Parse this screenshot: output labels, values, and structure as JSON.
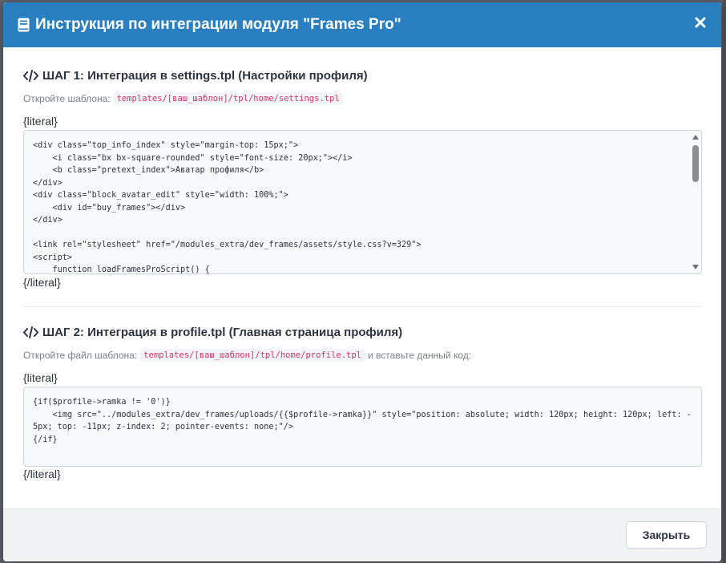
{
  "modal": {
    "title": "Инструкция по интеграции модуля \"Frames Pro\"",
    "close_label": "×",
    "footer_button_label": "Закрыть"
  },
  "step1": {
    "title": "ШАГ 1: Интеграция в settings.tpl (Настройки профиля)",
    "hint_prefix": "Откройте шаблона:",
    "path": "templates/[ваш_шаблон]/tpl/home/settings.tpl",
    "literal_open": "{literal}",
    "literal_close": "{/literal}",
    "code": "<div class=\"top_info_index\" style=\"margin-top: 15px;\">\n    <i class=\"bx bx-square-rounded\" style=\"font-size: 20px;\"></i>\n    <b class=\"pretext_index\">Аватар профиля</b>\n</div>\n<div class=\"block_avatar_edit\" style=\"width: 100%;\">\n    <div id=\"buy_frames\"></div>\n</div>\n\n<link rel=\"stylesheet\" href=\"/modules_extra/dev_frames/assets/style.css?v=329\">\n<script>\n    function loadFramesProScript() {"
  },
  "step2": {
    "title": "ШАГ 2: Интеграция в profile.tpl (Главная страница профиля)",
    "hint_prefix": "Откройте файл шаблона:",
    "path": "templates/[ваш_шаблон]/tpl/home/profile.tpl",
    "hint_suffix": "и вставьте данный код:",
    "literal_open": "{literal}",
    "literal_close": "{/literal}",
    "code": "{if($profile->ramka != '0')}\n    <img src=\"../modules_extra/dev_frames/uploads/{{$profile->ramka}}\" style=\"position: absolute; width: 120px; height: 120px; left: -5px; top: -11px; z-index: 2; pointer-events: none;\"/>\n{/if}"
  },
  "icons": {
    "header": "book-icon",
    "step": "code-icon",
    "close": "close-icon"
  },
  "colors": {
    "header_bg": "#2a7fc0",
    "path_text": "#d6336c",
    "code_bg": "#f7f8fa"
  }
}
